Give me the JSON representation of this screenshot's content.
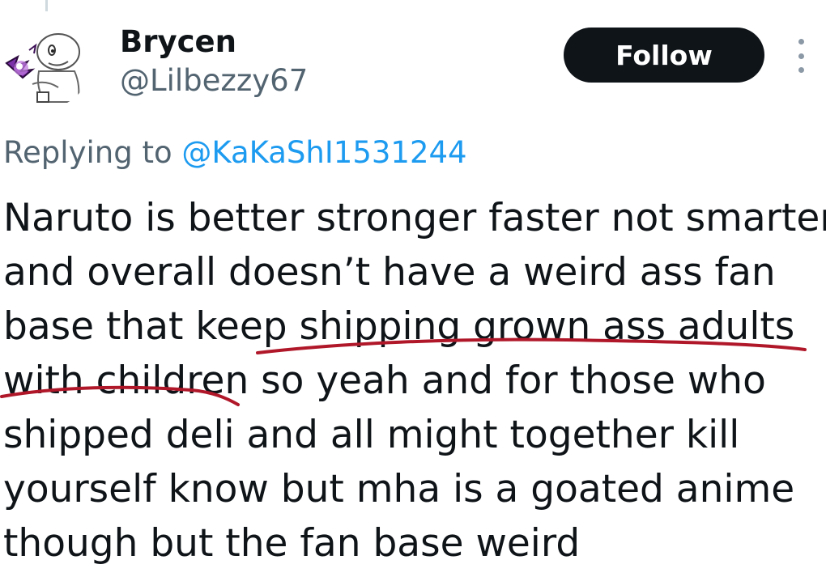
{
  "author": {
    "name": "Brycen",
    "handle": "@Lilbezzy67"
  },
  "actions": {
    "follow_label": "Follow"
  },
  "reply": {
    "prefix": "Replying to ",
    "mention": "@KaKaShI1531244"
  },
  "tweet": {
    "lines": [
      "Naruto is better stronger faster not smarter",
      "and overall doesn’t have a weird ass fan",
      "base that keep shipping grown ass adults",
      "with children so yeah and for those who",
      "shipped deli and all might  together kill",
      "yourself know but mha is a goated anime",
      "though but the fan base weird"
    ]
  },
  "colors": {
    "text": "#0f1419",
    "secondary_text": "#536471",
    "link": "#1d9bf0",
    "follow_button_bg": "#0f1419",
    "underline_annotation": "#b0182a"
  },
  "icons": {
    "more": "more-vertical-icon"
  }
}
